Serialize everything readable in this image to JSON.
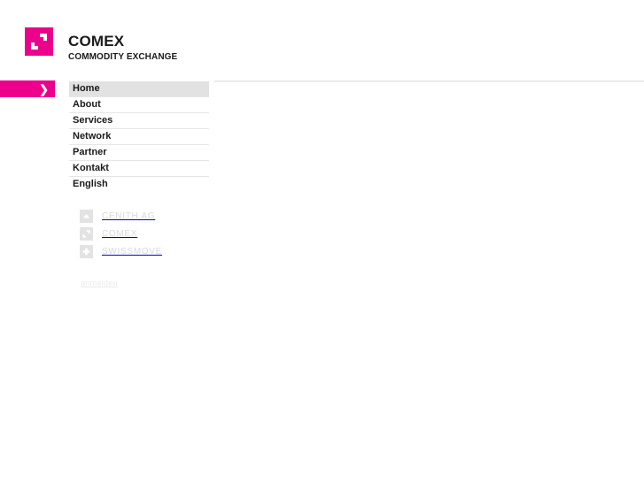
{
  "brand": {
    "title": "COMEX",
    "subtitle": "COMMODITY EXCHANGE",
    "logo_icon": "comex-square-logo-icon",
    "accent_color": "#ec008c"
  },
  "arrow_bar": {
    "icon": "chevron-right-icon",
    "glyph": "❯",
    "color": "#ec008c"
  },
  "nav": {
    "items": [
      {
        "label": "Home",
        "active": true
      },
      {
        "label": "About",
        "active": false
      },
      {
        "label": "Services",
        "active": false
      },
      {
        "label": "Network",
        "active": false
      },
      {
        "label": "Partner",
        "active": false
      },
      {
        "label": "Kontakt",
        "active": false
      },
      {
        "label": "English",
        "active": false
      }
    ],
    "active_background": "#e2e2e2"
  },
  "brand_links": [
    {
      "label": "CENITH AG",
      "icon": "chevron-up-icon"
    },
    {
      "label": "COMEX",
      "icon": "comex-square-logo-icon"
    },
    {
      "label": "SWISSMOVE",
      "icon": "plus-icon"
    }
  ],
  "login": {
    "label": "anmelden"
  }
}
